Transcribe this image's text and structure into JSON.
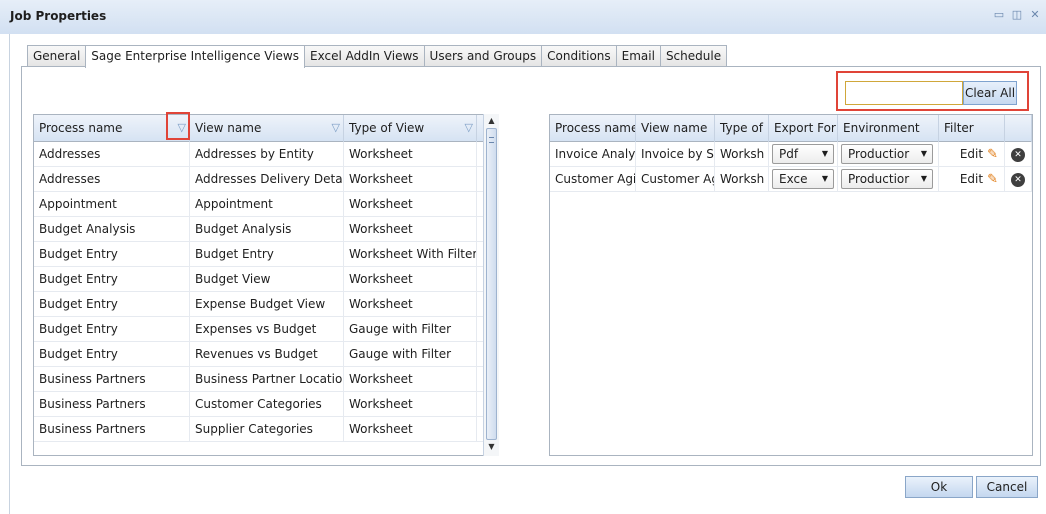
{
  "window": {
    "title": "Job Properties",
    "controls": [
      "▭",
      "◫",
      "✕"
    ]
  },
  "tabs": [
    {
      "label": "General"
    },
    {
      "label": "Sage Enterprise Intelligence Views"
    },
    {
      "label": "Excel AddIn Views"
    },
    {
      "label": "Users and Groups"
    },
    {
      "label": "Conditions"
    },
    {
      "label": "Email"
    },
    {
      "label": "Schedule"
    }
  ],
  "left_grid": {
    "headers": {
      "process": "Process name",
      "view": "View name",
      "type": "Type of View"
    },
    "rows": [
      {
        "process": "Addresses",
        "view": "Addresses by Entity",
        "type": "Worksheet"
      },
      {
        "process": "Addresses",
        "view": "Addresses Delivery Details",
        "type": "Worksheet"
      },
      {
        "process": "Appointment",
        "view": "Appointment",
        "type": "Worksheet"
      },
      {
        "process": "Budget Analysis",
        "view": "Budget Analysis",
        "type": "Worksheet"
      },
      {
        "process": "Budget Entry",
        "view": "Budget Entry",
        "type": "Worksheet With Filter"
      },
      {
        "process": "Budget Entry",
        "view": "Budget View",
        "type": "Worksheet"
      },
      {
        "process": "Budget Entry",
        "view": "Expense Budget View",
        "type": "Worksheet"
      },
      {
        "process": "Budget Entry",
        "view": "Expenses vs Budget",
        "type": "Gauge with Filter"
      },
      {
        "process": "Budget Entry",
        "view": "Revenues vs Budget",
        "type": "Gauge with Filter"
      },
      {
        "process": "Business Partners",
        "view": "Business Partner Locations",
        "type": "Worksheet"
      },
      {
        "process": "Business Partners",
        "view": "Customer Categories",
        "type": "Worksheet"
      },
      {
        "process": "Business Partners",
        "view": "Supplier Categories",
        "type": "Worksheet"
      }
    ]
  },
  "search": {
    "value": "",
    "clear_label": "Clear All"
  },
  "right_grid": {
    "headers": {
      "process": "Process name",
      "view": "View name",
      "type": "Type of",
      "export": "Export For",
      "env": "Environment",
      "filter": "Filter"
    },
    "rows": [
      {
        "process": "Invoice Analy:",
        "view": "Invoice by Sa",
        "type": "Worksh",
        "export": "Pdf",
        "env": "Productior",
        "filter": "Edit"
      },
      {
        "process": "Customer Agi",
        "view": "Customer Agi",
        "type": "Worksh",
        "export": "Exce",
        "env": "Productior",
        "filter": "Edit"
      }
    ]
  },
  "footer": {
    "ok_label": "Ok",
    "cancel_label": "Cancel"
  },
  "colors": {
    "highlight_red": "#e04438",
    "header_blue": "#d6e3f3",
    "border": "#aab4c0"
  }
}
